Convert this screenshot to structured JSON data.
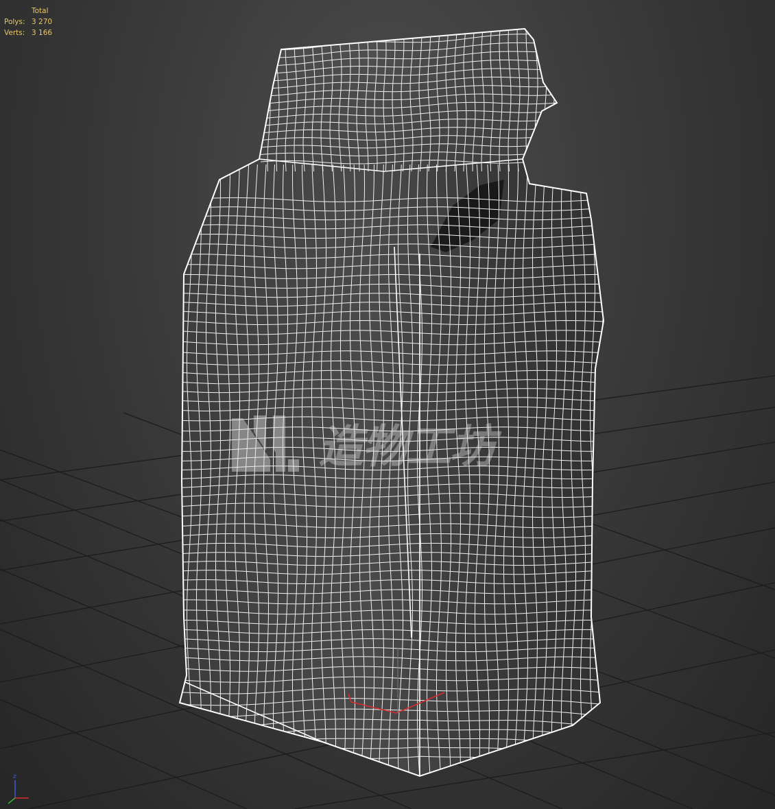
{
  "stats": {
    "header": "Total",
    "polys_label": "Polys:",
    "polys_value": "3 270",
    "verts_label": "Verts:",
    "verts_value": "3 166"
  },
  "watermark": {
    "text": "造物工坊",
    "logo": "nc-logo"
  },
  "gizmo": {
    "z_label": "z",
    "icon": "axis-gizmo-icon"
  },
  "viewport": {
    "object": "bag-wireframe",
    "colors": {
      "background": "#3a3a3a",
      "grid": "#1c1c1c",
      "wire": "#f2f2f2",
      "selection_axis": "#d92b2b",
      "stats_text": "#e8c76a"
    }
  }
}
